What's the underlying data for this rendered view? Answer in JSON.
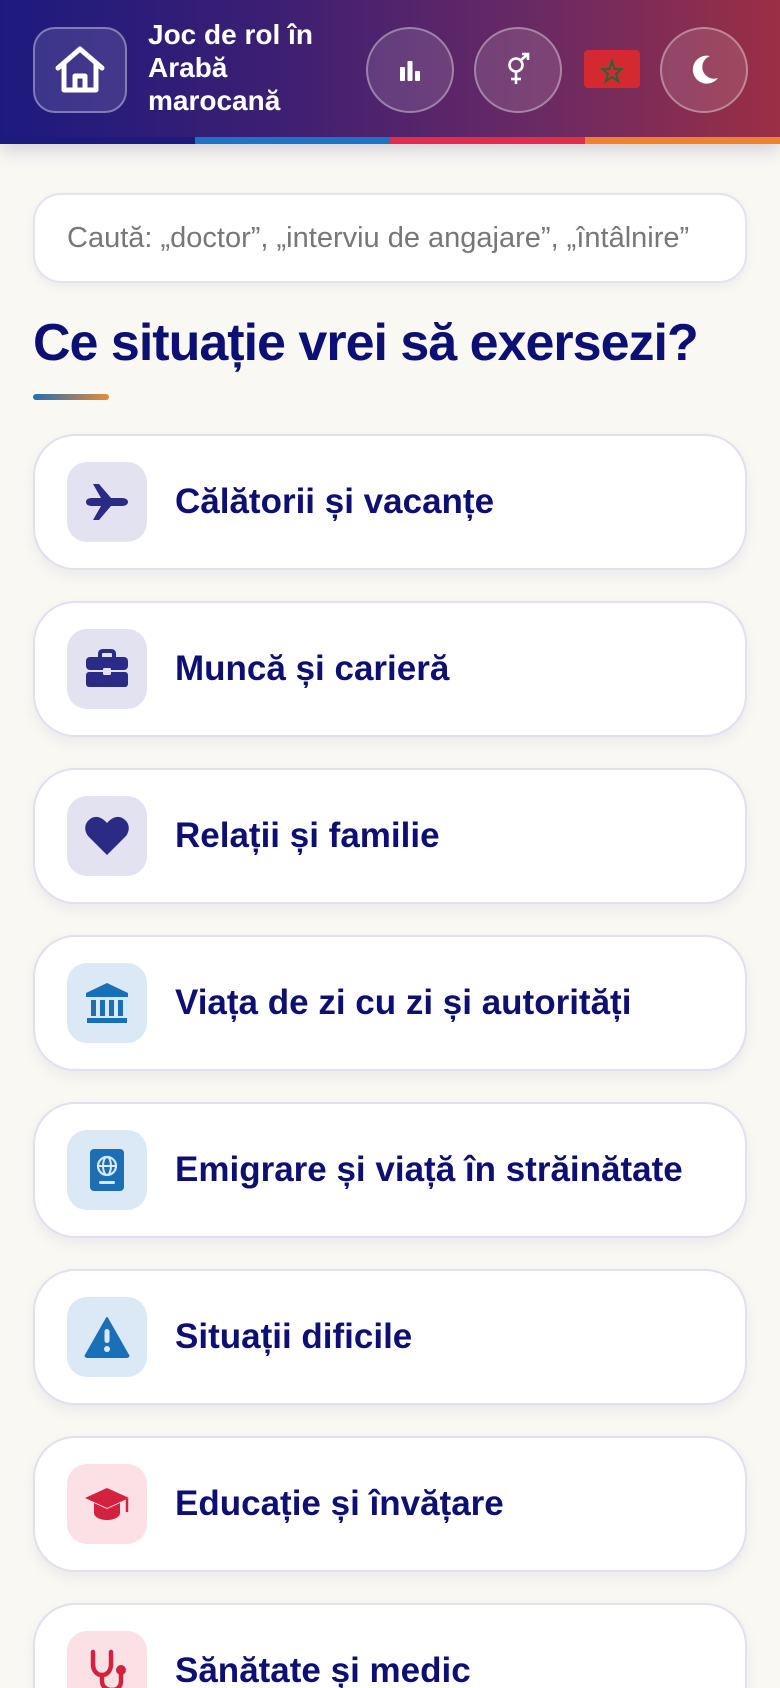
{
  "app": {
    "title": "Joc de rol în Arabă marocană"
  },
  "header": {
    "icons": [
      "home-icon",
      "stats-icon",
      "gender-icon",
      "flag-morocco",
      "moon-icon"
    ],
    "stripe_colors": [
      "#1d1a7e",
      "#1f72c4",
      "#e02d4d",
      "#ef8230"
    ]
  },
  "search": {
    "placeholder": "Caută: „doctor”, „interviu de angajare”, „întâlnire”",
    "value": ""
  },
  "main": {
    "heading": "Ce situație vrei să exersezi?",
    "categories": [
      {
        "label": "Călătorii și vacanțe",
        "icon": "plane-icon",
        "tint": "indigo"
      },
      {
        "label": "Muncă și carieră",
        "icon": "briefcase-icon",
        "tint": "indigo"
      },
      {
        "label": "Relații și familie",
        "icon": "heart-icon",
        "tint": "indigo"
      },
      {
        "label": "Viața de zi cu zi și autorități",
        "icon": "building-icon",
        "tint": "blue"
      },
      {
        "label": "Emigrare și viață în străinătate",
        "icon": "passport-icon",
        "tint": "blue"
      },
      {
        "label": "Situații dificile",
        "icon": "warning-icon",
        "tint": "blue"
      },
      {
        "label": "Educație și învățare",
        "icon": "graduation-cap-icon",
        "tint": "red"
      },
      {
        "label": "Sănătate și medic",
        "icon": "stethoscope-icon",
        "tint": "red"
      }
    ]
  },
  "colors": {
    "header_start": "#1d1a7e",
    "header_end": "#9a2f45",
    "text_primary": "#0e0f72",
    "icon_indigo": "#2b2b85",
    "icon_blue": "#1b6fb5",
    "icon_red": "#d3223f"
  }
}
